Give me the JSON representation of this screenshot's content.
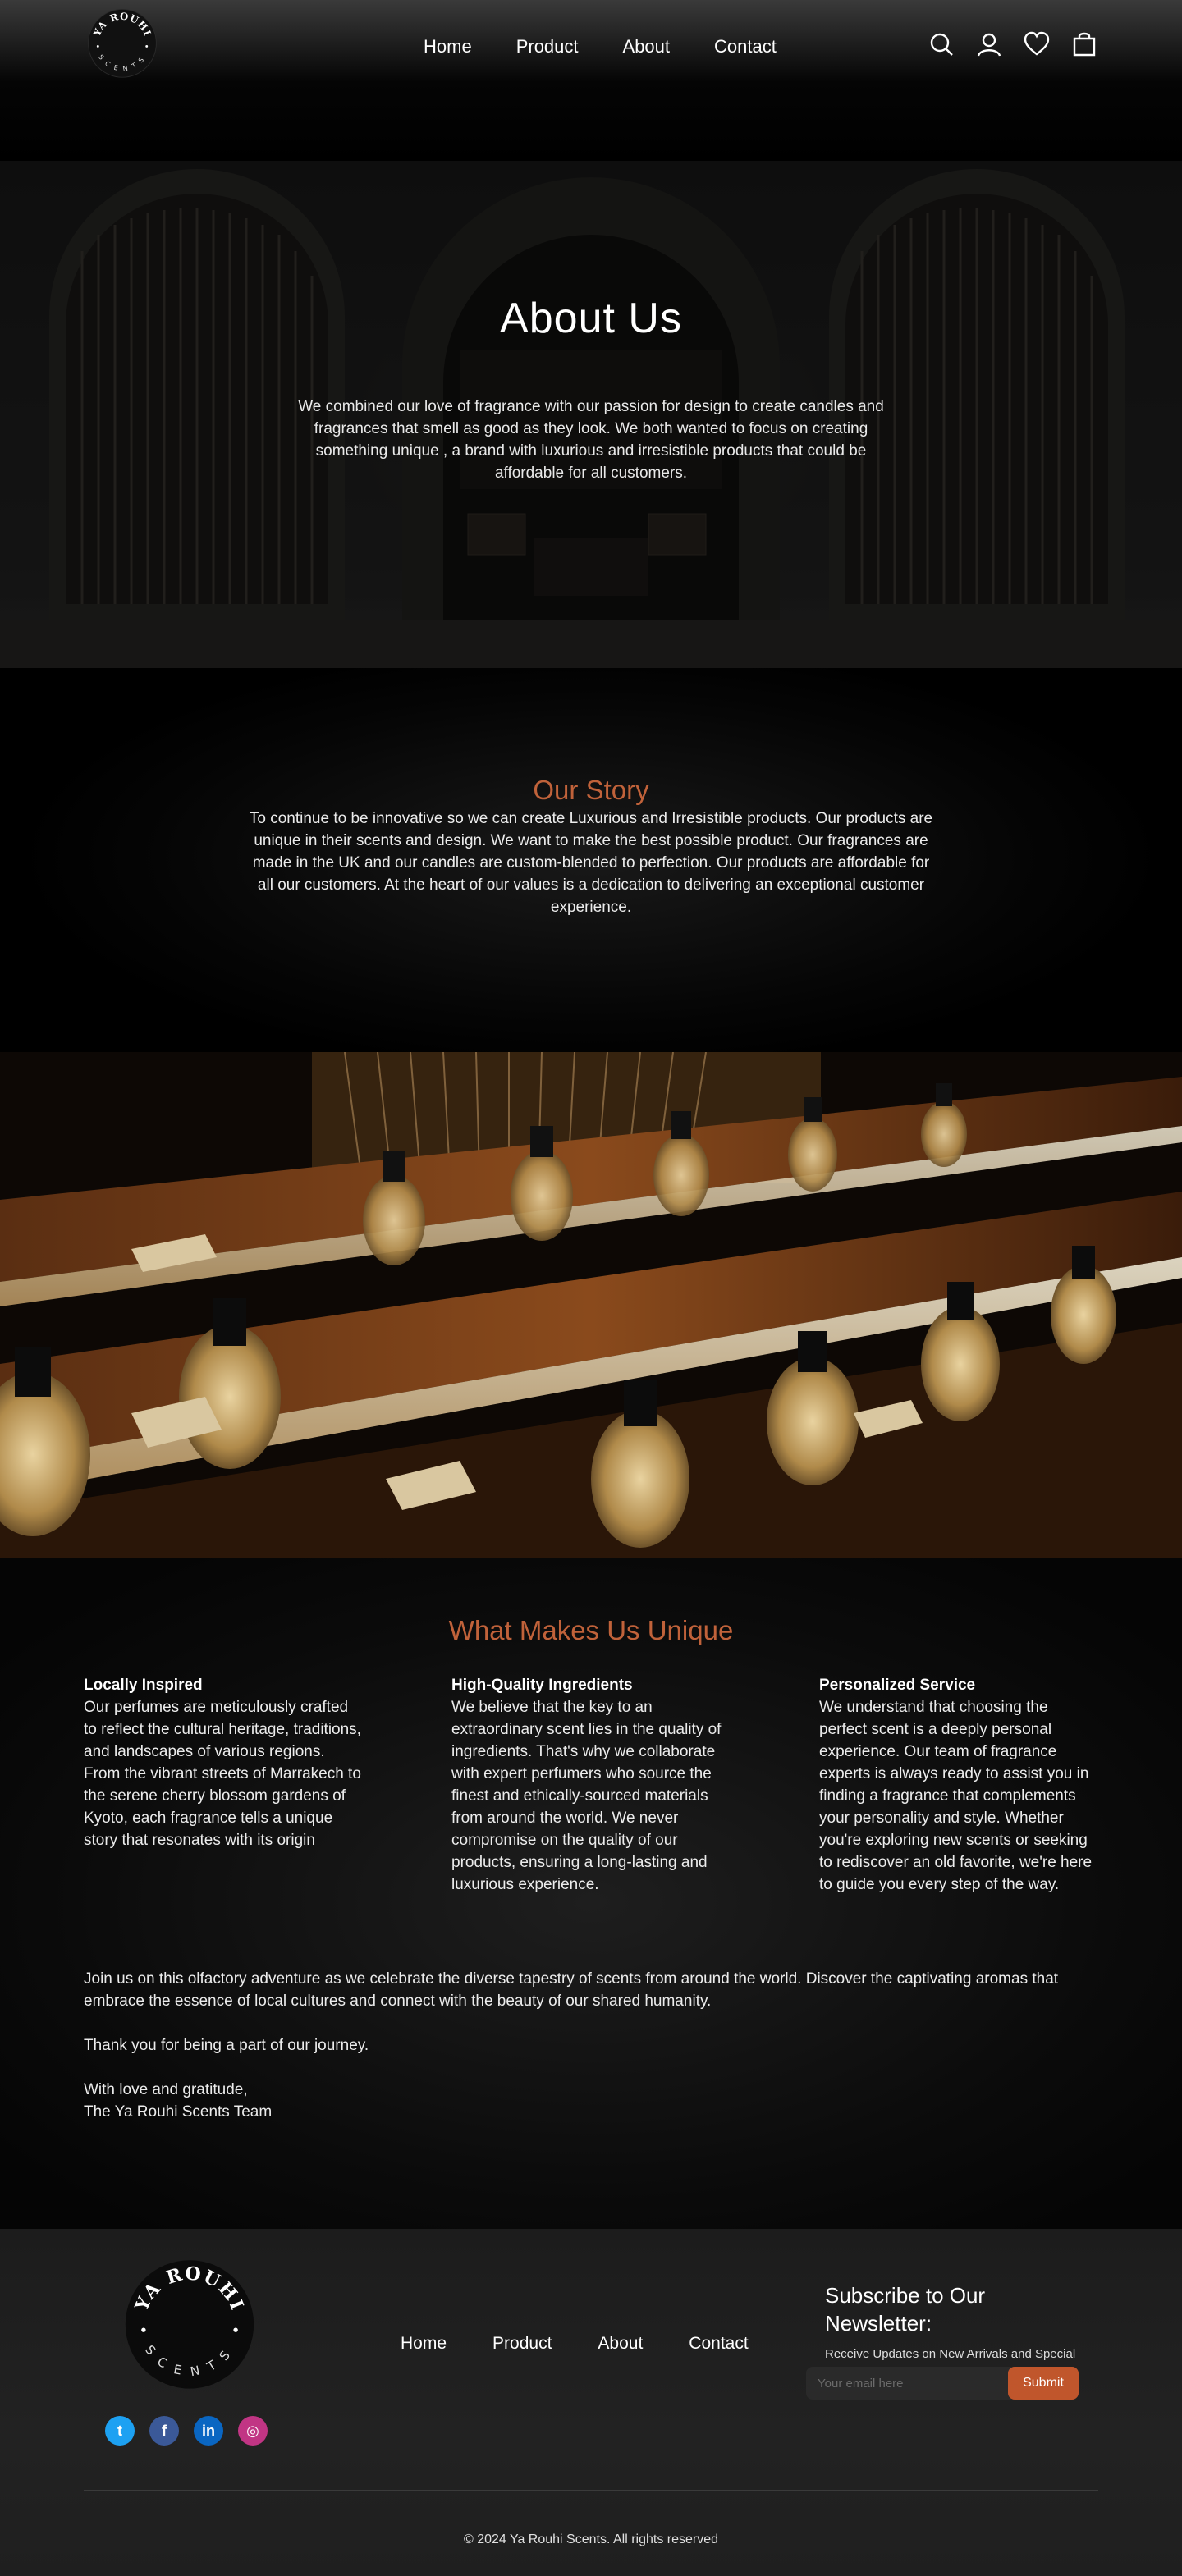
{
  "header": {
    "logo_text_top": "YA ROUHI",
    "logo_text_bottom": "SCENTS",
    "nav": [
      "Home",
      "Product",
      "About",
      "Contact"
    ],
    "icons": [
      "search-icon",
      "account-icon",
      "heart-icon",
      "shopping-bag-icon"
    ]
  },
  "hero": {
    "title": "About Us",
    "text": "We combined our love of fragrance with our passion for design to create candles and fragrances that smell as good as they look. We both wanted to focus on creating something unique , a brand with luxurious and irresistible products that could be affordable for all customers."
  },
  "story": {
    "title": "Our Story",
    "text": "To continue to be innovative so we can create Luxurious and Irresistible products. Our products are unique in their scents and design. We want to make the best possible product. Our fragrances are made in the UK and our candles are custom-blended to perfection. Our products are affordable for all our customers. At the heart of our values is a dedication to delivering an exceptional customer experience."
  },
  "unique": {
    "title": "What Makes Us Unique",
    "columns": [
      {
        "title": "Locally Inspired",
        "text": "Our perfumes are meticulously crafted to reflect the cultural heritage, traditions, and landscapes of various regions. From the vibrant streets of Marrakech to the serene cherry blossom gardens of Kyoto, each fragrance tells a unique story that resonates with its origin"
      },
      {
        "title": "High-Quality Ingredients",
        "text": "We believe that the key to an extraordinary scent lies in the quality of ingredients. That's why we collaborate with expert perfumers who source the finest and ethically-sourced materials from around the world. We never compromise on the quality of our products, ensuring a long-lasting and luxurious experience."
      },
      {
        "title": "Personalized Service",
        "text": "We understand that choosing the perfect scent is a deeply personal experience. Our team of fragrance experts is always ready to assist you in finding a fragrance that complements your personality and style. Whether you're exploring new scents or seeking to rediscover an old favorite, we're here to guide you every step of the way."
      }
    ],
    "closing": [
      "Join us on this olfactory adventure as we celebrate the diverse tapestry of scents from around the world. Discover the captivating aromas that embrace the essence of local cultures and connect with the beauty of our shared humanity.",
      "Thank you for being a part of our journey.",
      "With love and gratitude,",
      "The Ya Rouhi Scents Team"
    ]
  },
  "footer": {
    "logo_text_top": "YA ROUHI",
    "logo_text_bottom": "SCENTS",
    "social": [
      {
        "name": "twitter-icon",
        "glyph": "t",
        "color": "#1da1f2"
      },
      {
        "name": "facebook-icon",
        "glyph": "f",
        "color": "#3b5998"
      },
      {
        "name": "linkedin-icon",
        "glyph": "in",
        "color": "#0a66c2"
      },
      {
        "name": "instagram-icon",
        "glyph": "◎",
        "color": "#c13584"
      }
    ],
    "nav": [
      "Home",
      "Product",
      "About",
      "Contact"
    ],
    "newsletter_title": "Subscribe to Our Newsletter:",
    "newsletter_text": "Receive Updates on New Arrivals and Special Promotions!",
    "email_placeholder": "Your email here",
    "submit_label": "Submit",
    "copyright": "© 2024 Ya Rouhi Scents. All rights reserved"
  },
  "colors": {
    "accent": "#c0623a",
    "button": "#c0562c",
    "background": "#000000"
  }
}
